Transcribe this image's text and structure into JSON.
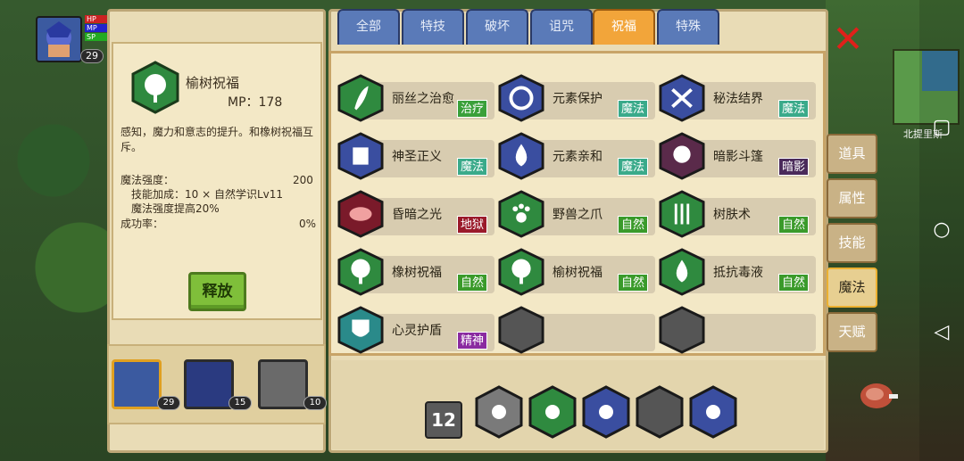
{
  "hud": {
    "level": "29",
    "bars": [
      "HP",
      "MP",
      "SP"
    ]
  },
  "skill_detail": {
    "name": "榆树祝福",
    "mp": "MP：178",
    "description": "感知，魔力和意志的提升。和橡树祝福互斥。",
    "magic_power_label": "魔法强度：",
    "magic_power_value": "200",
    "bonus_line": "技能加成：10 × 自然学识Lv11",
    "increase_line": "魔法强度提高20%",
    "success_label": "成功率：",
    "success_value": "0%",
    "release_label": "释放"
  },
  "party": [
    {
      "level": "29"
    },
    {
      "level": "15"
    },
    {
      "level": "10"
    }
  ],
  "tabs": [
    "全部",
    "特技",
    "破坏",
    "诅咒",
    "祝福",
    "特殊"
  ],
  "active_tab": "祝福",
  "skills": [
    [
      {
        "name": "丽丝之治愈",
        "tag": "治疗",
        "tag_color": "#3aa03a",
        "icon": "leaf-heal-icon",
        "hex": "#2f8a3f"
      },
      {
        "name": "元素保护",
        "tag": "魔法",
        "tag_color": "#3aaa8a",
        "icon": "swirl-icon",
        "hex": "#3a4ea0"
      },
      {
        "name": "秘法结界",
        "tag": "魔法",
        "tag_color": "#3aaa8a",
        "icon": "arcane-barrier-icon",
        "hex": "#3a4ea0"
      }
    ],
    [
      {
        "name": "神圣正义",
        "tag": "魔法",
        "tag_color": "#3aaa8a",
        "icon": "holy-fist-icon",
        "hex": "#3a4ea0"
      },
      {
        "name": "元素亲和",
        "tag": "魔法",
        "tag_color": "#3aaa8a",
        "icon": "water-drop-icon",
        "hex": "#3a4ea0"
      },
      {
        "name": "暗影斗篷",
        "tag": "暗影",
        "tag_color": "#4a2a5a",
        "icon": "shadow-cloak-icon",
        "hex": "#5a2a4a"
      }
    ],
    [
      {
        "name": "昏暗之光",
        "tag": "地狱",
        "tag_color": "#9a1a2a",
        "icon": "dark-light-icon",
        "hex": "#7a1a2a"
      },
      {
        "name": "野兽之爪",
        "tag": "自然",
        "tag_color": "#3a9a2a",
        "icon": "paw-icon",
        "hex": "#2f8a3f"
      },
      {
        "name": "树肤术",
        "tag": "自然",
        "tag_color": "#3a9a2a",
        "icon": "bark-skin-icon",
        "hex": "#2f8a3f"
      }
    ],
    [
      {
        "name": "橡树祝福",
        "tag": "自然",
        "tag_color": "#3a9a2a",
        "icon": "oak-tree-icon",
        "hex": "#2f8a3f"
      },
      {
        "name": "榆树祝福",
        "tag": "自然",
        "tag_color": "#3a9a2a",
        "icon": "elm-tree-icon",
        "hex": "#2f8a3f"
      },
      {
        "name": "抵抗毒液",
        "tag": "自然",
        "tag_color": "#3a9a2a",
        "icon": "poison-resist-icon",
        "hex": "#2f8a3f"
      }
    ],
    [
      {
        "name": "心灵护盾",
        "tag": "精神",
        "tag_color": "#8a2aa0",
        "icon": "mind-shield-icon",
        "hex": "#2a8a8a"
      },
      {
        "name": "",
        "tag": "",
        "tag_color": "",
        "icon": "empty-slot",
        "hex": "#555"
      },
      {
        "name": "",
        "tag": "",
        "tag_color": "",
        "icon": "empty-slot",
        "hex": "#555"
      }
    ]
  ],
  "quickbar": {
    "page": "12",
    "slots": [
      "shuriken-icon",
      "green-potion-icon",
      "purple-fire-icon",
      "empty-slot",
      "blue-dagger-icon"
    ]
  },
  "side_tabs": [
    "道具",
    "属性",
    "技能",
    "魔法",
    "天赋"
  ],
  "active_side_tab": "魔法",
  "map_label": "北提里斯"
}
